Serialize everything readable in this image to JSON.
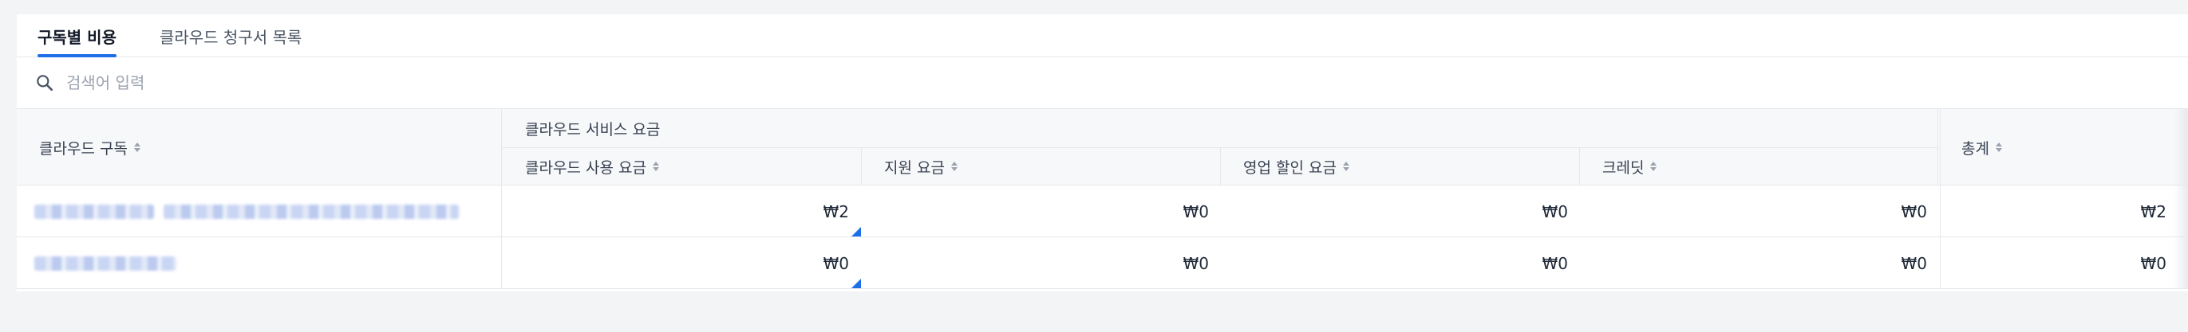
{
  "tabs": [
    {
      "label": "구독별 비용",
      "active": true
    },
    {
      "label": "클라우드 청구서 목록",
      "active": false
    }
  ],
  "search": {
    "placeholder": "검색어 입력",
    "value": ""
  },
  "table": {
    "columns": {
      "subscription": "클라우드 구독",
      "service_group": "클라우드 서비스 요금",
      "usage": "클라우드 사용 요금",
      "support": "지원 요금",
      "discount": "영업 할인 요금",
      "credit": "크레딧",
      "total": "총계"
    },
    "rows": [
      {
        "usage": "₩2",
        "support": "₩0",
        "discount": "₩0",
        "credit": "₩0",
        "total": "₩2"
      },
      {
        "usage": "₩0",
        "support": "₩0",
        "discount": "₩0",
        "credit": "₩0",
        "total": "₩0"
      }
    ]
  },
  "colors": {
    "accent": "#1d6ee8",
    "header_bg": "#f7f8fa",
    "border": "#e5e7eb"
  },
  "icons": {
    "search": "search-icon",
    "sort": "sort-icon"
  }
}
